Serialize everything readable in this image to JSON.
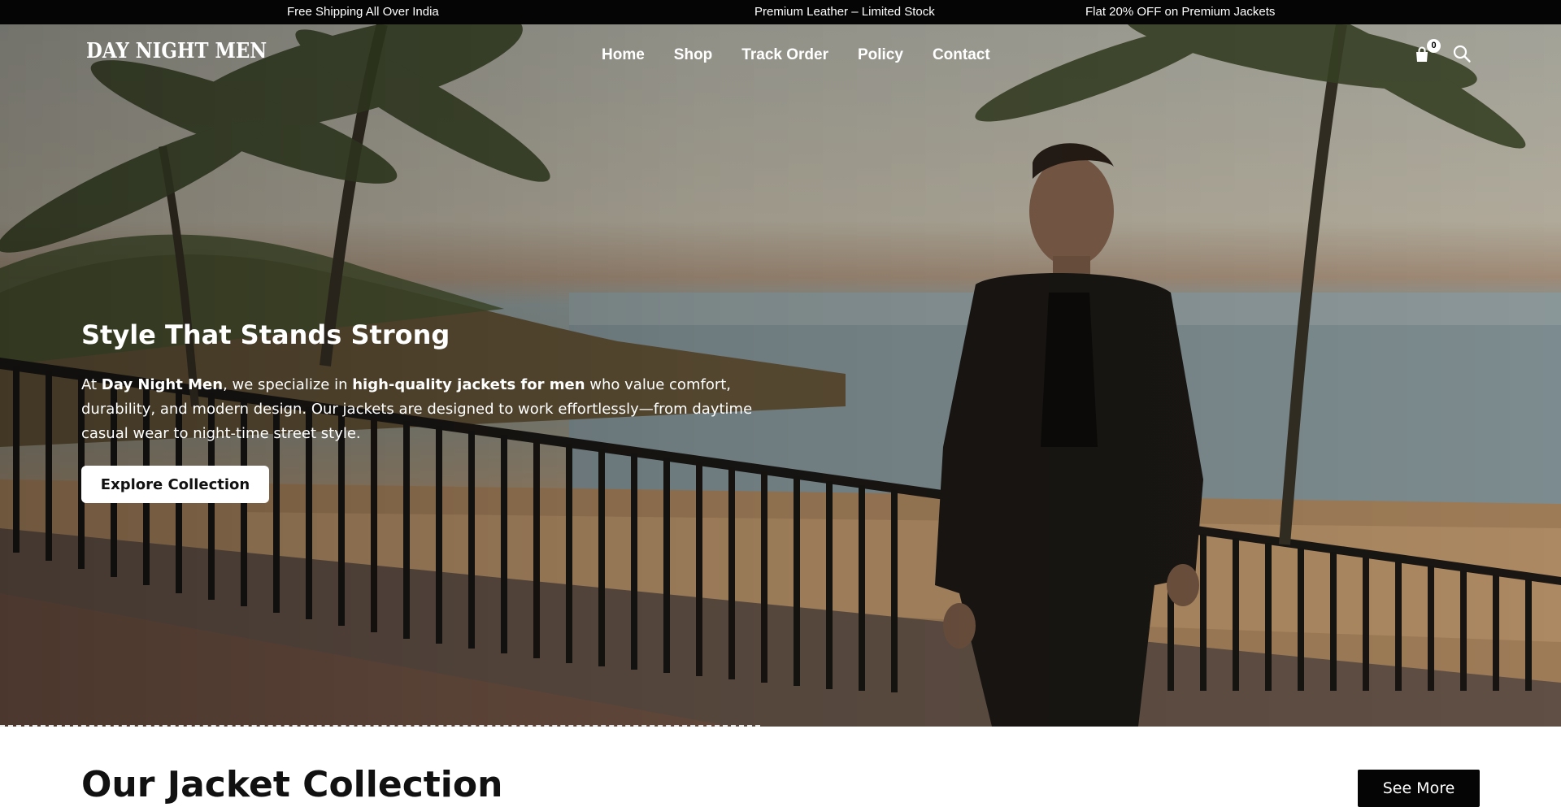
{
  "announcement": {
    "items": [
      "Free Shipping All Over India",
      "Premium Leather – Limited Stock",
      "Flat 20% OFF on Premium Jackets"
    ]
  },
  "header": {
    "logo": "DAY NIGHT MEN",
    "nav": [
      "Home",
      "Shop",
      "Track Order",
      "Policy",
      "Contact"
    ],
    "cart_count": "0",
    "icons": [
      "shopping-bag-icon",
      "search-icon"
    ]
  },
  "hero": {
    "title": "Style That Stands Strong",
    "text": {
      "p1": "At ",
      "brand": "Day Night Men",
      "p2": ", we specialize in ",
      "highlight": "high-quality jackets for men",
      "p3": " who value comfort, durability, and modern design. Our jackets are designed to work effortlessly—from daytime casual wear to night-time street style."
    },
    "cta": "Explore Collection"
  },
  "collection": {
    "title": "Our Jacket Collection",
    "see_more": "See More"
  },
  "colors": {
    "announcement_bg": "#050505",
    "button_dark": "#050505",
    "button_light": "#ffffff"
  }
}
